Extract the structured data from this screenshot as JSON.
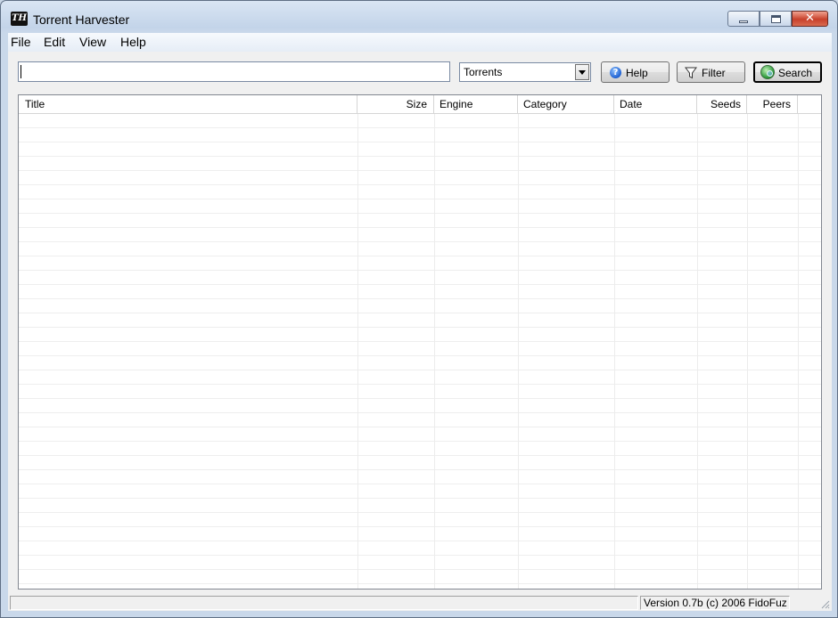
{
  "window": {
    "title": "Torrent Harvester",
    "icon_text": "TH"
  },
  "caption_buttons": {
    "close_glyph": "✕"
  },
  "menu": {
    "items": [
      "File",
      "Edit",
      "View",
      "Help"
    ]
  },
  "toolbar": {
    "search_value": "",
    "type_selected": "Torrents",
    "help_label": "Help",
    "filter_label": "Filter",
    "search_label": "Search"
  },
  "results": {
    "columns": [
      "Title",
      "Size",
      "Engine",
      "Category",
      "Date",
      "Seeds",
      "Peers"
    ],
    "rows": []
  },
  "status": {
    "left_text": "",
    "version_text": "Version 0.7b (c) 2006 FidoFuz"
  },
  "colors": {
    "title_bar": "#c3d4e9",
    "close_button": "#c8412b",
    "list_grid": "#eeeeee"
  }
}
